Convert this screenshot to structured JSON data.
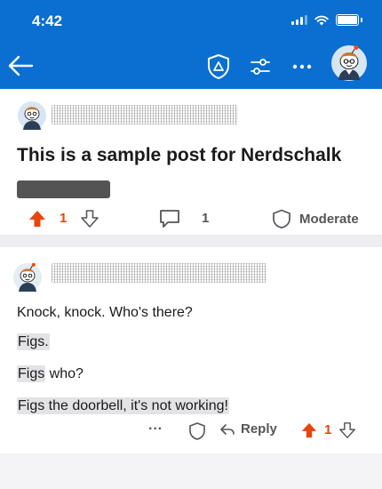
{
  "status_bar": {
    "time": "4:42"
  },
  "header": {
    "icons": [
      "back-arrow-icon",
      "mod-shield-icon",
      "filter-icon",
      "more-icon",
      "snoo-avatar-icon"
    ]
  },
  "post": {
    "title": "This is a sample post for Nerdschalk",
    "upvotes": "1",
    "comments": "1",
    "moderate_label": "Moderate"
  },
  "comment": {
    "lines": [
      {
        "highlight": "",
        "rest": "Knock, knock. Who's there?"
      },
      {
        "highlight": "Figs.",
        "rest": ""
      },
      {
        "highlight": "Figs",
        "rest": " who?"
      },
      {
        "highlight": "Figs the doorbell, it's not working!",
        "rest": ""
      }
    ],
    "more_label": "···",
    "reply_label": "Reply",
    "upvotes": "1"
  },
  "colors": {
    "header_bg": "#0a6fd1",
    "upvote": "#e8440b",
    "icon_gray": "#555555"
  }
}
